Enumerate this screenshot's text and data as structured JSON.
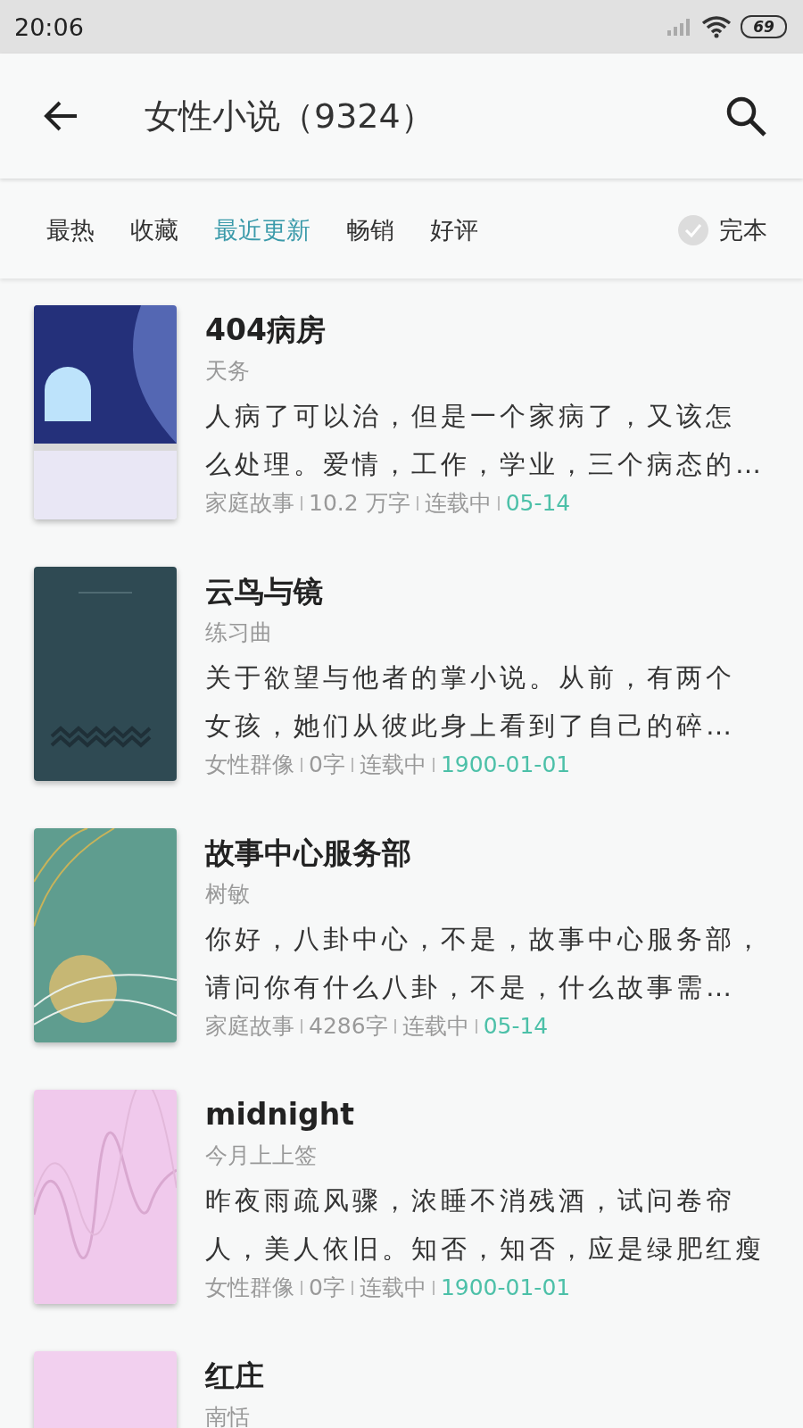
{
  "status_bar": {
    "time": "20:06",
    "battery": "69"
  },
  "header": {
    "title": "女性小说（9324）"
  },
  "filters": [
    {
      "label": "最热",
      "selected": false
    },
    {
      "label": "收藏",
      "selected": false
    },
    {
      "label": "最近更新",
      "selected": true
    },
    {
      "label": "畅销",
      "selected": false
    },
    {
      "label": "好评",
      "selected": false
    }
  ],
  "complete_filter": {
    "label": "完本",
    "checked": false
  },
  "books": [
    {
      "cover": {
        "kind": "picture"
      },
      "title": "404病房",
      "author": "天务",
      "description_lines": [
        "人病了可以治，但是一个家病了，又该怎",
        "么处理。爱情，工作，学业，三个病态的…"
      ],
      "meta": [
        "家庭故事",
        "10.2 万字",
        "连载中"
      ],
      "date": "05-14"
    },
    {
      "cover": {
        "kind": "picture"
      },
      "title": "云鸟与镜",
      "author": "练习曲",
      "description_lines": [
        "关于欲望与他者的掌小说。从前，有两个",
        "女孩，她们从彼此身上看到了自己的碎…"
      ],
      "meta": [
        "女性群像",
        "0字",
        "连载中"
      ],
      "date": "1900-01-01"
    },
    {
      "cover": {
        "kind": "picture"
      },
      "title": "故事中心服务部",
      "author": "树敏",
      "description_lines": [
        "你好，八卦中心，不是，故事中心服务部，",
        "请问你有什么八卦，不是，什么故事需…"
      ],
      "meta": [
        "家庭故事",
        "4286字",
        "连载中"
      ],
      "date": "05-14"
    },
    {
      "cover": {
        "kind": "picture"
      },
      "title": "midnight",
      "author": "今月上上签",
      "description_lines": [
        "昨夜雨疏风骤，浓睡不消残酒，试问卷帘",
        "人，美人依旧。知否，知否，应是绿肥红瘦"
      ],
      "meta": [
        "女性群像",
        "0字",
        "连载中"
      ],
      "date": "1900-01-01"
    },
    {
      "cover": {
        "kind": "picture"
      },
      "title": "红庄",
      "author": "南恬"
    }
  ]
}
